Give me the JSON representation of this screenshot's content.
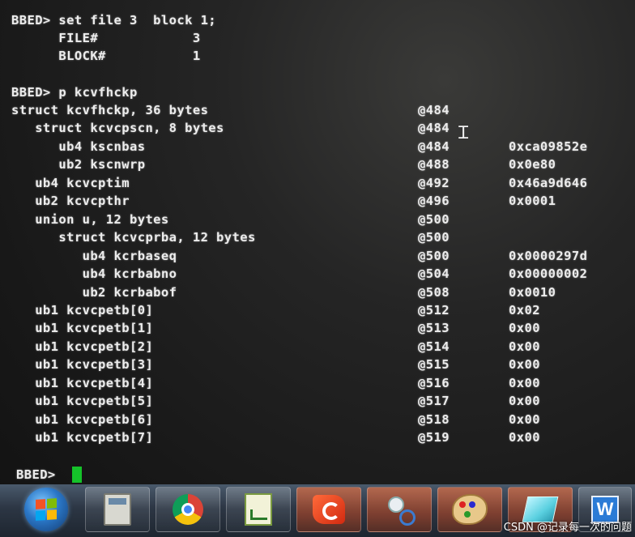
{
  "terminal": {
    "lines": [
      {
        "text": "BBED> set file 3  block 1;",
        "addr": "",
        "val": ""
      },
      {
        "text": "      FILE#            3",
        "addr": "",
        "val": ""
      },
      {
        "text": "      BLOCK#           1",
        "addr": "",
        "val": ""
      },
      {
        "text": "",
        "addr": "",
        "val": ""
      },
      {
        "text": "BBED> p kcvfhckp",
        "addr": "",
        "val": ""
      },
      {
        "text": "struct kcvfhckp, 36 bytes",
        "addr": "@484",
        "val": ""
      },
      {
        "text": "   struct kcvcpscn, 8 bytes",
        "addr": "@484",
        "val": ""
      },
      {
        "text": "      ub4 kscnbas",
        "addr": "@484",
        "val": "0xca09852e"
      },
      {
        "text": "      ub2 kscnwrp",
        "addr": "@488",
        "val": "0x0e80"
      },
      {
        "text": "   ub4 kcvcptim",
        "addr": "@492",
        "val": "0x46a9d646"
      },
      {
        "text": "   ub2 kcvcpthr",
        "addr": "@496",
        "val": "0x0001"
      },
      {
        "text": "   union u, 12 bytes",
        "addr": "@500",
        "val": ""
      },
      {
        "text": "      struct kcvcprba, 12 bytes",
        "addr": "@500",
        "val": ""
      },
      {
        "text": "         ub4 kcrbaseq",
        "addr": "@500",
        "val": "0x0000297d"
      },
      {
        "text": "         ub4 kcrbabno",
        "addr": "@504",
        "val": "0x00000002"
      },
      {
        "text": "         ub2 kcrbabof",
        "addr": "@508",
        "val": "0x0010"
      },
      {
        "text": "   ub1 kcvcpetb[0]",
        "addr": "@512",
        "val": "0x02"
      },
      {
        "text": "   ub1 kcvcpetb[1]",
        "addr": "@513",
        "val": "0x00"
      },
      {
        "text": "   ub1 kcvcpetb[2]",
        "addr": "@514",
        "val": "0x00"
      },
      {
        "text": "   ub1 kcvcpetb[3]",
        "addr": "@515",
        "val": "0x00"
      },
      {
        "text": "   ub1 kcvcpetb[4]",
        "addr": "@516",
        "val": "0x00"
      },
      {
        "text": "   ub1 kcvcpetb[5]",
        "addr": "@517",
        "val": "0x00"
      },
      {
        "text": "   ub1 kcvcpetb[6]",
        "addr": "@518",
        "val": "0x00"
      },
      {
        "text": "   ub1 kcvcpetb[7]",
        "addr": "@519",
        "val": "0x00"
      }
    ],
    "prompt": "BBED>",
    "cursor_color": "#15c22a"
  },
  "taskbar": {
    "items": [
      {
        "name": "calculator-icon"
      },
      {
        "name": "chrome-icon"
      },
      {
        "name": "notepad-plus-plus-icon"
      },
      {
        "name": "red-g-app-icon"
      },
      {
        "name": "snipping-tool-icon"
      },
      {
        "name": "paint-icon"
      },
      {
        "name": "glass-window-icon"
      },
      {
        "name": "word-icon"
      }
    ],
    "word_letter": "W"
  },
  "watermark": "CSDN @记录每一次的问题"
}
